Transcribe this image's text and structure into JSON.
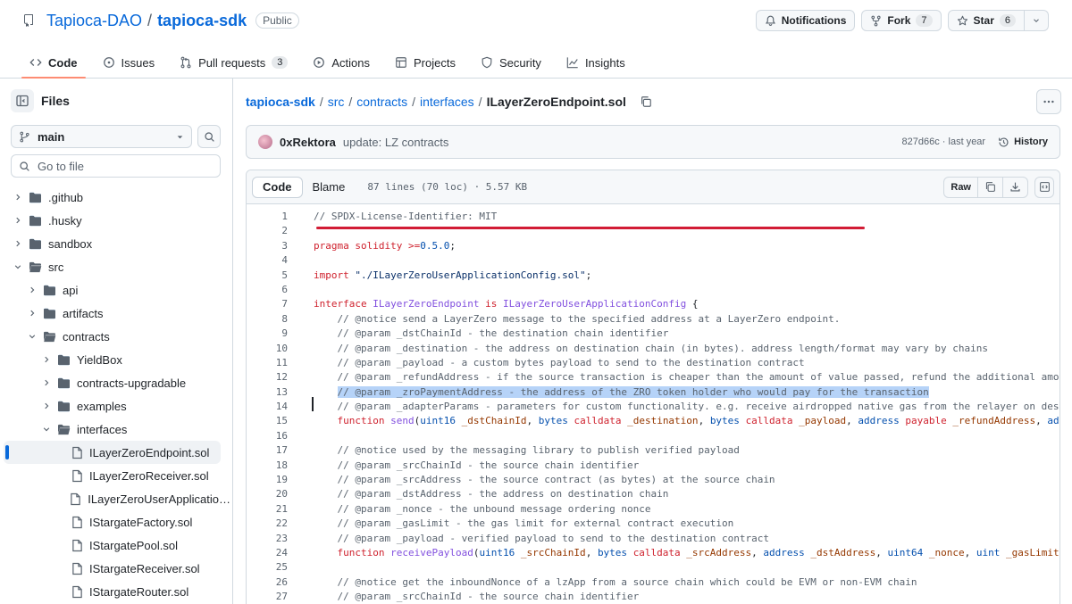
{
  "repo": {
    "owner": "Tapioca-DAO",
    "separator": "/",
    "name": "tapioca-sdk",
    "visibility": "Public"
  },
  "header_actions": {
    "notifications": "Notifications",
    "fork": "Fork",
    "fork_count": "7",
    "star": "Star",
    "star_count": "6"
  },
  "tabs": [
    {
      "label": "Code",
      "icon": "code-icon"
    },
    {
      "label": "Issues",
      "icon": "issue-icon"
    },
    {
      "label": "Pull requests",
      "icon": "pull-request-icon",
      "count": "3"
    },
    {
      "label": "Actions",
      "icon": "play-icon"
    },
    {
      "label": "Projects",
      "icon": "table-icon"
    },
    {
      "label": "Security",
      "icon": "shield-icon"
    },
    {
      "label": "Insights",
      "icon": "graph-icon"
    }
  ],
  "sidebar": {
    "title": "Files",
    "branch": "main",
    "goto_placeholder": "Go to file",
    "tree": [
      {
        "label": ".github",
        "type": "folder",
        "depth": 0,
        "expanded": false
      },
      {
        "label": ".husky",
        "type": "folder",
        "depth": 0,
        "expanded": false
      },
      {
        "label": "sandbox",
        "type": "folder",
        "depth": 0,
        "expanded": false
      },
      {
        "label": "src",
        "type": "folder",
        "depth": 0,
        "expanded": true
      },
      {
        "label": "api",
        "type": "folder",
        "depth": 1,
        "expanded": false
      },
      {
        "label": "artifacts",
        "type": "folder",
        "depth": 1,
        "expanded": false
      },
      {
        "label": "contracts",
        "type": "folder",
        "depth": 1,
        "expanded": true
      },
      {
        "label": "YieldBox",
        "type": "folder",
        "depth": 2,
        "expanded": false
      },
      {
        "label": "contracts-upgradable",
        "type": "folder",
        "depth": 2,
        "expanded": false
      },
      {
        "label": "examples",
        "type": "folder",
        "depth": 2,
        "expanded": false
      },
      {
        "label": "interfaces",
        "type": "folder",
        "depth": 2,
        "expanded": true
      },
      {
        "label": "ILayerZeroEndpoint.sol",
        "type": "file",
        "depth": 3,
        "selected": true
      },
      {
        "label": "ILayerZeroReceiver.sol",
        "type": "file",
        "depth": 3
      },
      {
        "label": "ILayerZeroUserApplicationCon...",
        "type": "file",
        "depth": 3
      },
      {
        "label": "IStargateFactory.sol",
        "type": "file",
        "depth": 3
      },
      {
        "label": "IStargatePool.sol",
        "type": "file",
        "depth": 3
      },
      {
        "label": "IStargateReceiver.sol",
        "type": "file",
        "depth": 3
      },
      {
        "label": "IStargateRouter.sol",
        "type": "file",
        "depth": 3
      }
    ]
  },
  "breadcrumb": {
    "parts": [
      "tapioca-sdk",
      "src",
      "contracts",
      "interfaces"
    ],
    "separator": "/",
    "current": "ILayerZeroEndpoint.sol"
  },
  "commit": {
    "author": "0xRektora",
    "message": "update: LZ contracts",
    "sha": "827d66c",
    "dot": "·",
    "age": "last year",
    "history": "History"
  },
  "file": {
    "tab_code": "Code",
    "tab_blame": "Blame",
    "info": "87 lines (70 loc) · 5.57 KB",
    "raw": "Raw",
    "highlighted_line": 13,
    "lines": [
      [
        [
          "c-com",
          "// SPDX-License-Identifier: MIT"
        ]
      ],
      [],
      [
        [
          "c-kw",
          "pragma"
        ],
        [
          "",
          " "
        ],
        [
          "c-kw",
          "solidity"
        ],
        [
          "",
          " "
        ],
        [
          "c-kw",
          ">="
        ],
        [
          "c-num",
          "0.5.0"
        ],
        [
          "",
          ";"
        ]
      ],
      [],
      [
        [
          "c-kw",
          "import"
        ],
        [
          "",
          " "
        ],
        [
          "c-str",
          "\"./ILayerZeroUserApplicationConfig.sol\""
        ],
        [
          "",
          ";"
        ]
      ],
      [],
      [
        [
          "c-kw",
          "interface"
        ],
        [
          "",
          " "
        ],
        [
          "c-ent",
          "ILayerZeroEndpoint"
        ],
        [
          "",
          " "
        ],
        [
          "c-kw",
          "is"
        ],
        [
          "",
          " "
        ],
        [
          "c-ent",
          "ILayerZeroUserApplicationConfig"
        ],
        [
          "",
          " {"
        ]
      ],
      [
        [
          "c-com",
          "    // @notice send a LayerZero message to the specified address at a LayerZero endpoint."
        ]
      ],
      [
        [
          "c-com",
          "    // @param _dstChainId - the destination chain identifier"
        ]
      ],
      [
        [
          "c-com",
          "    // @param _destination - the address on destination chain (in bytes). address length/format may vary by chains"
        ]
      ],
      [
        [
          "c-com",
          "    // @param _payload - a custom bytes payload to send to the destination contract"
        ]
      ],
      [
        [
          "c-com",
          "    // @param _refundAddress - if the source transaction is cheaper than the amount of value passed, refund the additional amount to this address"
        ]
      ],
      [
        [
          "",
          "    "
        ],
        [
          "sel c-com",
          "// @param _zroPaymentAddress - the address of the ZRO token holder who would pay for the transaction"
        ]
      ],
      [
        [
          "c-com",
          "    // @param _adapterParams - parameters for custom functionality. e.g. receive airdropped native gas from the relayer on destination"
        ]
      ],
      [
        [
          "",
          "    "
        ],
        [
          "c-kw",
          "function"
        ],
        [
          "",
          " "
        ],
        [
          "c-ent",
          "send"
        ],
        [
          "",
          "("
        ],
        [
          "c-typ",
          "uint16"
        ],
        [
          "",
          " "
        ],
        [
          "c-txt",
          "_dstChainId"
        ],
        [
          "",
          ", "
        ],
        [
          "c-typ",
          "bytes"
        ],
        [
          "",
          " "
        ],
        [
          "c-kw",
          "calldata"
        ],
        [
          "",
          " "
        ],
        [
          "c-txt",
          "_destination"
        ],
        [
          "",
          ", "
        ],
        [
          "c-typ",
          "bytes"
        ],
        [
          "",
          " "
        ],
        [
          "c-kw",
          "calldata"
        ],
        [
          "",
          " "
        ],
        [
          "c-txt",
          "_payload"
        ],
        [
          "",
          ", "
        ],
        [
          "c-typ",
          "address"
        ],
        [
          "",
          " "
        ],
        [
          "c-kw",
          "payable"
        ],
        [
          "",
          " "
        ],
        [
          "c-txt",
          "_refundAddress"
        ],
        [
          "",
          ", "
        ],
        [
          "c-typ",
          "address"
        ],
        [
          "",
          " "
        ],
        [
          "c-txt",
          "_zroPaymentAddress"
        ]
      ],
      [],
      [
        [
          "c-com",
          "    // @notice used by the messaging library to publish verified payload"
        ]
      ],
      [
        [
          "c-com",
          "    // @param _srcChainId - the source chain identifier"
        ]
      ],
      [
        [
          "c-com",
          "    // @param _srcAddress - the source contract (as bytes) at the source chain"
        ]
      ],
      [
        [
          "c-com",
          "    // @param _dstAddress - the address on destination chain"
        ]
      ],
      [
        [
          "c-com",
          "    // @param _nonce - the unbound message ordering nonce"
        ]
      ],
      [
        [
          "c-com",
          "    // @param _gasLimit - the gas limit for external contract execution"
        ]
      ],
      [
        [
          "c-com",
          "    // @param _payload - verified payload to send to the destination contract"
        ]
      ],
      [
        [
          "",
          "    "
        ],
        [
          "c-kw",
          "function"
        ],
        [
          "",
          " "
        ],
        [
          "c-ent",
          "receivePayload"
        ],
        [
          "",
          "("
        ],
        [
          "c-typ",
          "uint16"
        ],
        [
          "",
          " "
        ],
        [
          "c-txt",
          "_srcChainId"
        ],
        [
          "",
          ", "
        ],
        [
          "c-typ",
          "bytes"
        ],
        [
          "",
          " "
        ],
        [
          "c-kw",
          "calldata"
        ],
        [
          "",
          " "
        ],
        [
          "c-txt",
          "_srcAddress"
        ],
        [
          "",
          ", "
        ],
        [
          "c-typ",
          "address"
        ],
        [
          "",
          " "
        ],
        [
          "c-txt",
          "_dstAddress"
        ],
        [
          "",
          ", "
        ],
        [
          "c-typ",
          "uint64"
        ],
        [
          "",
          " "
        ],
        [
          "c-txt",
          "_nonce"
        ],
        [
          "",
          ", "
        ],
        [
          "c-typ",
          "uint"
        ],
        [
          "",
          " "
        ],
        [
          "c-txt",
          "_gasLimit"
        ],
        [
          "",
          ", "
        ],
        [
          "c-typ",
          "bytes"
        ],
        [
          "",
          " "
        ],
        [
          "c-kw",
          "calldata"
        ],
        [
          "",
          " "
        ],
        [
          "c-txt",
          "_payload"
        ]
      ],
      [],
      [
        [
          "c-com",
          "    // @notice get the inboundNonce of a lzApp from a source chain which could be EVM or non-EVM chain"
        ]
      ],
      [
        [
          "c-com",
          "    // @param _srcChainId - the source chain identifier"
        ]
      ]
    ]
  }
}
